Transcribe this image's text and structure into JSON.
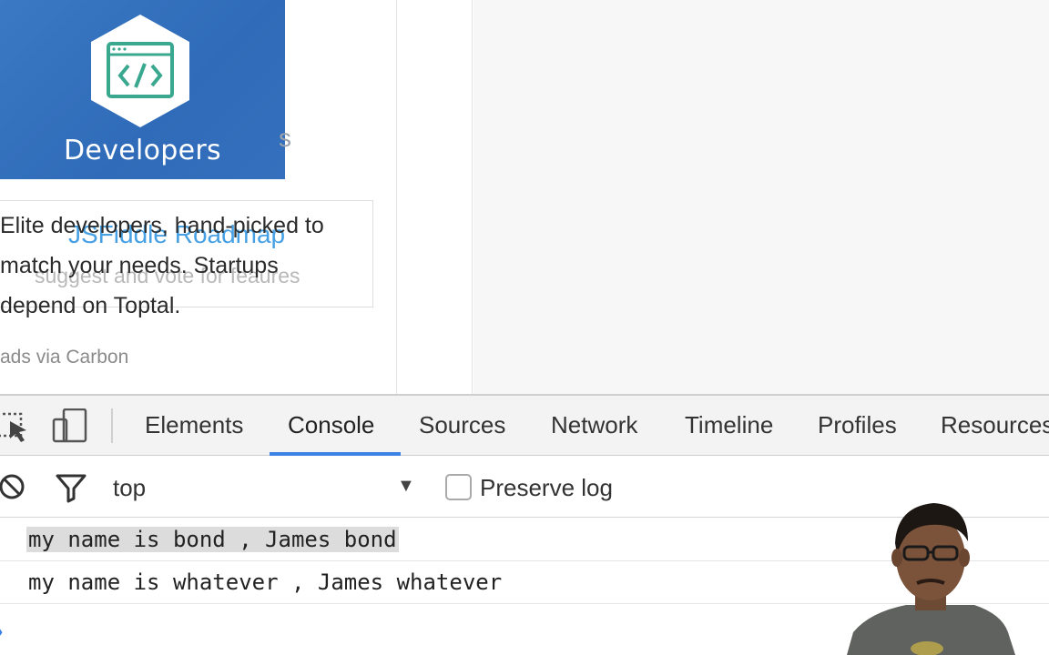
{
  "ad": {
    "brand": "Developers",
    "ghost_char": "s",
    "roadmap_title": "JSFiddle Roadmap",
    "roadmap_sub": "suggest and vote for feaures",
    "text_lines": [
      "Elite developers, hand-picked to",
      "match your needs. Startups",
      "depend on Toptal."
    ],
    "via": "ads via Carbon",
    "logo_icon": "code-window-icon",
    "colors": {
      "banner": "#3470bd",
      "logo_outline": "#3aa88f"
    }
  },
  "devtools": {
    "tabs": [
      "Elements",
      "Console",
      "Sources",
      "Network",
      "Timeline",
      "Profiles",
      "Resources"
    ],
    "active_tab": "Console",
    "accent": "#3b82e6",
    "console": {
      "context": "top",
      "preserve_log_label": "Preserve log",
      "preserve_log_checked": false,
      "logs": [
        "my name is bond , James bond",
        "my name is whatever , James whatever"
      ],
      "prompt_symbol": "›"
    }
  }
}
